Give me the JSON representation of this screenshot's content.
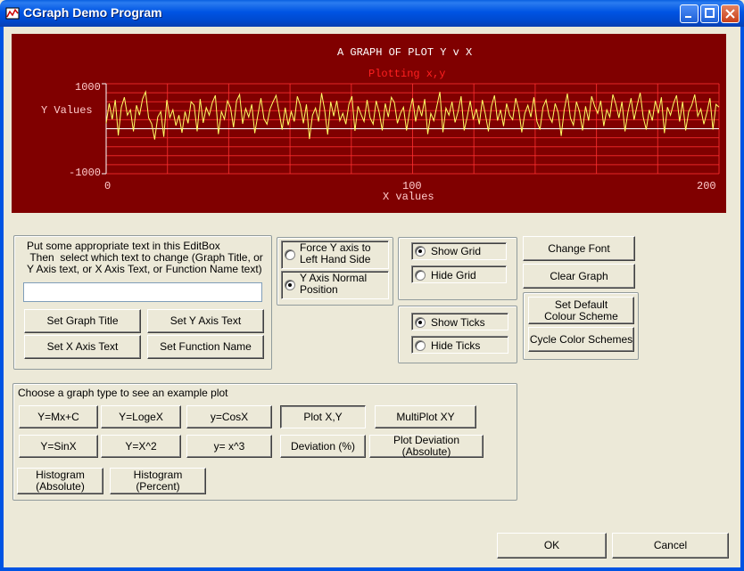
{
  "window": {
    "title": "CGraph Demo Program"
  },
  "graph": {
    "title": "A GRAPH OF PLOT Y v X",
    "subtitle": "Plotting x,y",
    "y_axis_label": "Y Values",
    "x_axis_label": "X values",
    "y_ticks": [
      "1000",
      "-1000"
    ],
    "x_ticks": [
      "0",
      "100",
      "200"
    ],
    "colors": {
      "background": "#800000",
      "grid": "#ff3030",
      "trace": "#ffff66",
      "axis": "#ffffff",
      "title": "#ffffff",
      "subtitle": "#ff2020",
      "labels": "#ffcccc"
    }
  },
  "chart_data": {
    "type": "line",
    "title": "A GRAPH OF PLOT Y v X",
    "subtitle": "Plotting x,y",
    "xlabel": "X values",
    "ylabel": "Y Values",
    "xlim": [
      0,
      200
    ],
    "ylim": [
      -1000,
      1000
    ],
    "grid": true,
    "series": [
      {
        "values": [
          120,
          560,
          210,
          640,
          -150,
          480,
          700,
          300,
          420,
          -60,
          520,
          300,
          660,
          820,
          240,
          110,
          -240,
          260,
          380,
          -180,
          640,
          250,
          420,
          70,
          300,
          -90,
          380,
          120,
          600,
          520,
          -60,
          660,
          130,
          470,
          300,
          580,
          740,
          -120,
          380,
          210,
          620,
          470,
          30,
          620,
          760,
          110,
          450,
          260,
          540,
          -100,
          300,
          680,
          220,
          100,
          440,
          600,
          740,
          360,
          -20,
          470,
          80,
          380,
          160,
          720,
          520,
          120,
          540,
          -230,
          300,
          460,
          160,
          790,
          420,
          -130,
          600,
          280,
          620,
          180,
          340,
          100,
          540,
          720,
          -50,
          500,
          320,
          160,
          640,
          240,
          100,
          620,
          360,
          -40,
          560,
          260,
          700,
          580,
          120,
          340,
          480,
          -40,
          380,
          680,
          160,
          520,
          280,
          660,
          -120,
          340,
          180,
          500,
          820,
          -80,
          460,
          300,
          600,
          140,
          380,
          720,
          -40,
          260,
          620,
          200,
          440,
          100,
          640,
          320,
          -60,
          500,
          740,
          180,
          420,
          60,
          560,
          300,
          200,
          680,
          420,
          -80,
          340,
          520,
          260,
          700,
          160,
          -20,
          480,
          640,
          280,
          140,
          560,
          360,
          -160,
          420,
          780,
          240,
          80,
          600,
          380,
          -40,
          500,
          180,
          720,
          500,
          340,
          620,
          60,
          420,
          260,
          760,
          540,
          240,
          600,
          -60,
          380,
          680,
          200,
          520,
          800,
          260,
          -20,
          420,
          180,
          620,
          340,
          700,
          -100,
          480,
          300,
          560,
          740,
          160,
          600,
          -40,
          380,
          520,
          760,
          280,
          440,
          100,
          360,
          680,
          -20,
          540,
          480
        ]
      }
    ]
  },
  "editbox": {
    "instructions": "Put some appropriate text in this EditBox\n Then  select which text to change (Graph Title, or Y Axis text, or X Axis Text, or Function Name text)",
    "value": ""
  },
  "buttons": {
    "set_graph_title": "Set Graph Title",
    "set_y_axis_text": "Set Y Axis Text",
    "set_x_axis_text": "Set X Axis Text",
    "set_function_name": "Set Function Name",
    "change_font": "Change Font",
    "clear_graph": "Clear Graph",
    "set_default_colour": "Set Default Colour Scheme",
    "cycle_color": "Cycle Color Schemes",
    "ok": "OK",
    "cancel": "Cancel"
  },
  "y_axis_options": [
    {
      "label": "Force Y axis to Left Hand Side",
      "selected": false
    },
    {
      "label": "Y Axis Normal Position",
      "selected": true
    }
  ],
  "grid_options": [
    {
      "label": "Show Grid",
      "selected": true
    },
    {
      "label": "Hide Grid",
      "selected": false
    }
  ],
  "tick_options": [
    {
      "label": "Show Ticks",
      "selected": true
    },
    {
      "label": "Hide Ticks",
      "selected": false
    }
  ],
  "graph_types": {
    "caption": "Choose a graph type to see an example plot",
    "items": [
      "Y=Mx+C",
      "Y=LogeX",
      "y=CosX",
      "Plot X,Y",
      "MultiPlot XY",
      "Y=SinX",
      "Y=X^2",
      "y= x^3",
      "Deviation (%)",
      "Plot Deviation (Absolute)",
      "Histogram\n(Absolute)",
      "Histogram\n(Percent)"
    ],
    "selected": "Plot X,Y"
  }
}
